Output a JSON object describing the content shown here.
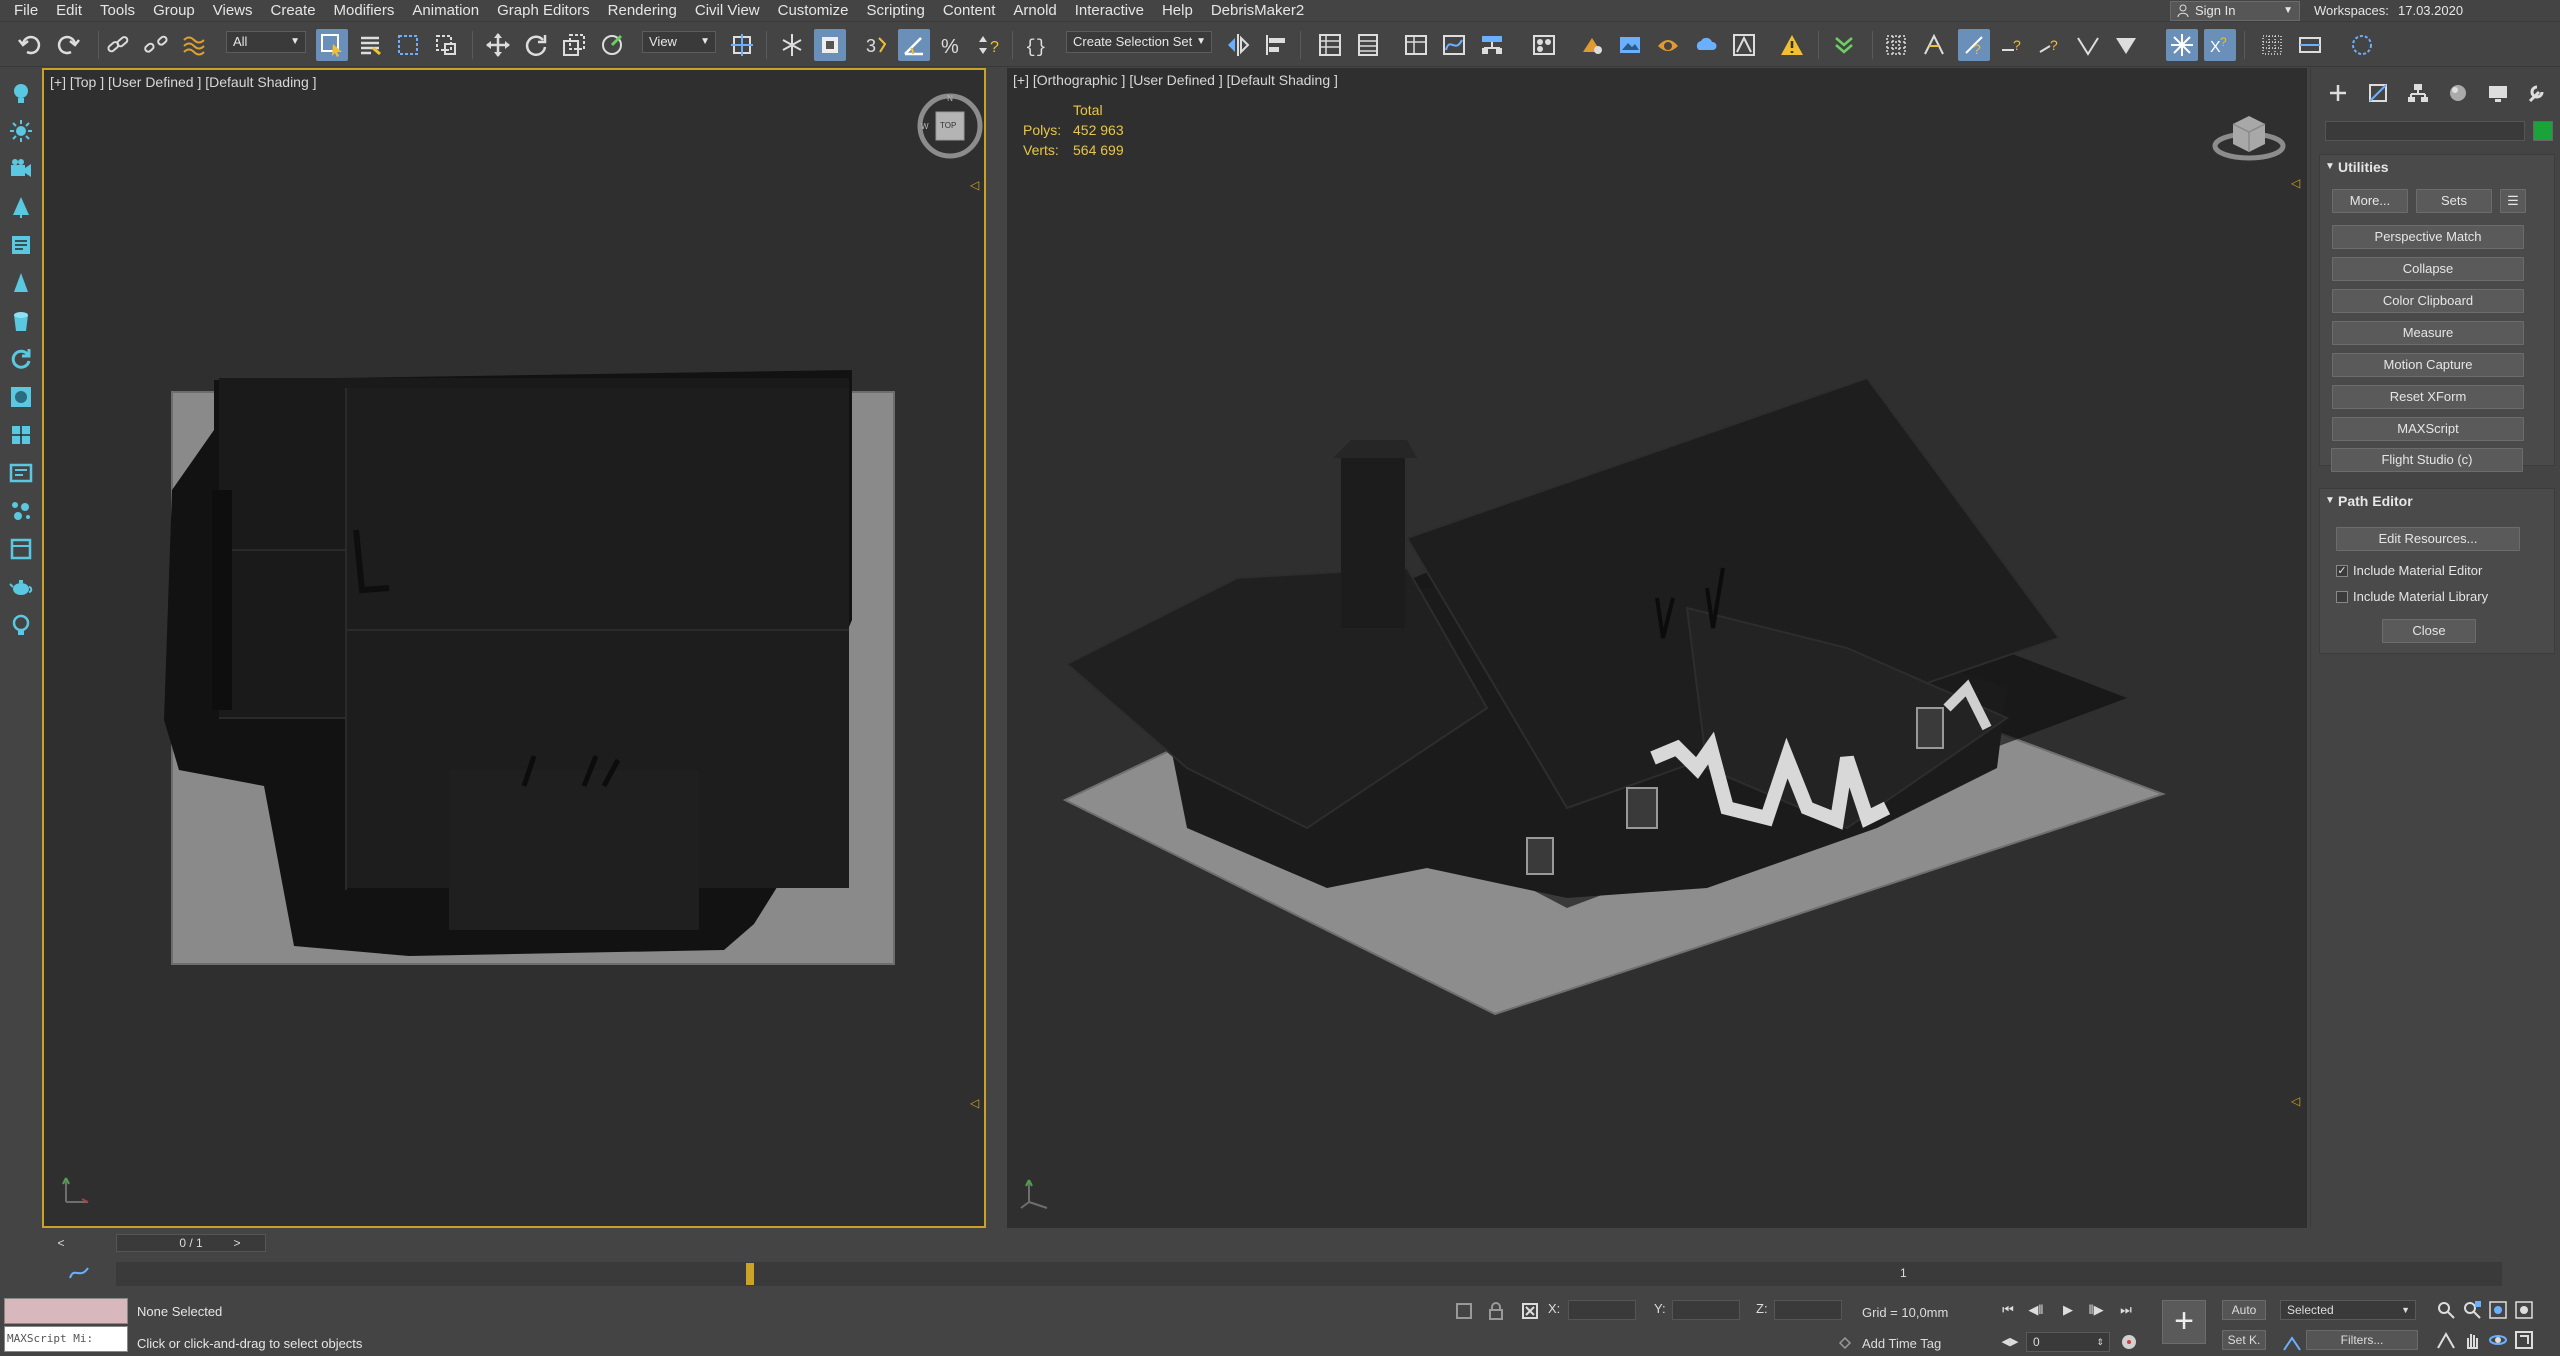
{
  "menu": [
    "File",
    "Edit",
    "Tools",
    "Group",
    "Views",
    "Create",
    "Modifiers",
    "Animation",
    "Graph Editors",
    "Rendering",
    "Civil View",
    "Customize",
    "Scripting",
    "Content",
    "Arnold",
    "Interactive",
    "Help",
    "DebrisMaker2"
  ],
  "account": {
    "sign_in": "Sign In",
    "workspaces_label": "Workspaces:",
    "workspace": "17.03.2020"
  },
  "toolbar": {
    "filter": "All",
    "ref_coord": "View",
    "selection_set": "Create Selection Set"
  },
  "viewports": {
    "left": {
      "label": "[+] [Top ] [User Defined ] [Default Shading ]",
      "navcube": "TOP"
    },
    "right": {
      "label": "[+] [Orthographic ] [User Defined ] [Default Shading ]",
      "stats_header": "Total",
      "polys_label": "Polys:",
      "polys": "452 963",
      "verts_label": "Verts:",
      "verts": "564 699"
    }
  },
  "command_panel": {
    "utilities": {
      "title": "Utilities",
      "more": "More...",
      "sets": "Sets",
      "items": [
        "Perspective Match",
        "Collapse",
        "Color Clipboard",
        "Measure",
        "Motion Capture",
        "Reset XForm",
        "MAXScript",
        "Flight Studio (c)"
      ]
    },
    "path_editor": {
      "title": "Path Editor",
      "edit_resources": "Edit Resources...",
      "include_material_editor": "Include Material Editor",
      "include_material_editor_checked": true,
      "include_material_library": "Include Material Library",
      "include_material_library_checked": false,
      "close": "Close"
    }
  },
  "timeline": {
    "frame": "0 / 1",
    "prev": "<",
    "next": ">",
    "track_tick": "1"
  },
  "status": {
    "maxscript": "MAXScript Mi:",
    "selection": "None Selected",
    "prompt": "Click or click-and-drag to select objects",
    "x_label": "X:",
    "y_label": "Y:",
    "z_label": "Z:",
    "grid": "Grid = 10,0mm",
    "add_time_tag": "Add Time Tag",
    "auto": "Auto",
    "set_key": "Set K.",
    "key_filter": "Selected",
    "filters": "Filters...",
    "current_frame": "0"
  },
  "colors": {
    "accent": "#c9a227",
    "active_button": "#6a8fb8",
    "object_color": "#1aa33a",
    "viewport_bg": "#2f2f2f"
  }
}
